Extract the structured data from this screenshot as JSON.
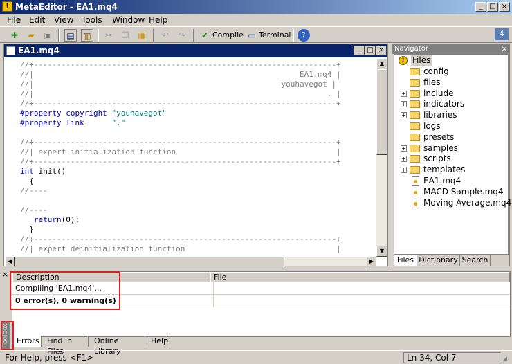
{
  "window": {
    "title": "MetaEditor - EA1.mq4",
    "min": "_",
    "max": "□",
    "close": "×",
    "badge": "4"
  },
  "menu": [
    "File",
    "Edit",
    "View",
    "Tools",
    "Window",
    "Help"
  ],
  "toolbar": {
    "compile_label": "Compile",
    "terminal_label": "Terminal"
  },
  "editor": {
    "title": "EA1.mq4",
    "lines": [
      [
        [
          "c-com",
          "//+------------------------------------------------------------------+"
        ]
      ],
      [
        [
          "c-com",
          "//|                                                          EA1.mq4 |"
        ]
      ],
      [
        [
          "c-com",
          "//|                                                      youhavegot |"
        ]
      ],
      [
        [
          "c-com",
          "//|                                                                . |"
        ]
      ],
      [
        [
          "c-com",
          "//+------------------------------------------------------------------+"
        ]
      ],
      [
        [
          "c-kw",
          "#property copyright "
        ],
        [
          "c-str",
          "\"youhavegot\""
        ]
      ],
      [
        [
          "c-kw",
          "#property link      "
        ],
        [
          "c-str",
          "\".\""
        ]
      ],
      [
        [
          "c-pl",
          ""
        ]
      ],
      [
        [
          "c-com",
          "//+------------------------------------------------------------------+"
        ]
      ],
      [
        [
          "c-com",
          "//| expert initialization function                                   |"
        ]
      ],
      [
        [
          "c-com",
          "//+------------------------------------------------------------------+"
        ]
      ],
      [
        [
          "c-kw",
          "int"
        ],
        [
          "c-pl",
          " init()"
        ]
      ],
      [
        [
          "c-pl",
          "  {"
        ]
      ],
      [
        [
          "c-com",
          "//----"
        ]
      ],
      [
        [
          "c-pl",
          ""
        ]
      ],
      [
        [
          "c-com",
          "//----"
        ]
      ],
      [
        [
          "c-pl",
          "   "
        ],
        [
          "c-kw",
          "return"
        ],
        [
          "c-pl",
          "(0);"
        ]
      ],
      [
        [
          "c-pl",
          "  }"
        ]
      ],
      [
        [
          "c-com",
          "//+------------------------------------------------------------------+"
        ]
      ],
      [
        [
          "c-com",
          "//| expert deinitialization function                                 |"
        ]
      ]
    ]
  },
  "navigator": {
    "title": "Navigator",
    "root": "Files",
    "items": [
      {
        "label": "config",
        "type": "folder",
        "expandable": false
      },
      {
        "label": "files",
        "type": "folder",
        "expandable": false
      },
      {
        "label": "include",
        "type": "folder",
        "expandable": true
      },
      {
        "label": "indicators",
        "type": "folder",
        "expandable": true
      },
      {
        "label": "libraries",
        "type": "folder",
        "expandable": true
      },
      {
        "label": "logs",
        "type": "folder",
        "expandable": false
      },
      {
        "label": "presets",
        "type": "folder",
        "expandable": false
      },
      {
        "label": "samples",
        "type": "folder",
        "expandable": true
      },
      {
        "label": "scripts",
        "type": "folder",
        "expandable": true
      },
      {
        "label": "templates",
        "type": "folder",
        "expandable": true
      },
      {
        "label": "EA1.mq4",
        "type": "file",
        "expandable": false
      },
      {
        "label": "MACD Sample.mq4",
        "type": "file",
        "expandable": false
      },
      {
        "label": "Moving Average.mq4",
        "type": "file",
        "expandable": false
      }
    ],
    "tabs": [
      "Files",
      "Dictionary",
      "Search"
    ]
  },
  "toolbox": {
    "label": "Toolbox",
    "headers": [
      "Description",
      "File"
    ],
    "rows": [
      {
        "description": "Compiling 'EA1.mq4'...",
        "file": "",
        "bold": false
      },
      {
        "description": "0 error(s), 0 warning(s)",
        "file": "",
        "bold": true
      }
    ],
    "tabs": [
      "Errors",
      "Find in Files",
      "Online Library",
      "Help"
    ]
  },
  "status": {
    "help": "For Help, press <F1>",
    "position": "Ln 34, Col 7"
  },
  "colors": {
    "title_active": "#0a246a",
    "comment": "#808080",
    "keyword": "#0000c8",
    "string": "#008080",
    "highlight": "#e02020"
  }
}
